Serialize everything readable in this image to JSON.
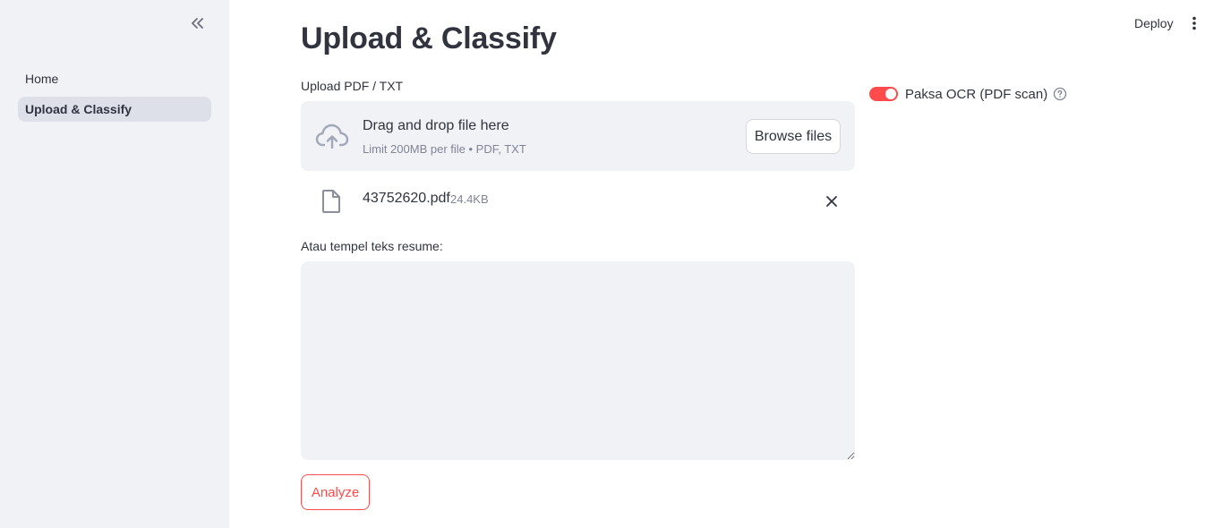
{
  "sidebar": {
    "collapse_icon": "double-chevron-left-icon",
    "items": [
      {
        "label": "Home",
        "active": false
      },
      {
        "label": "Upload & Classify",
        "active": true
      }
    ]
  },
  "topbar": {
    "deploy_label": "Deploy",
    "menu_icon": "vertical-ellipsis-icon"
  },
  "main": {
    "title": "Upload & Classify",
    "uploader": {
      "label": "Upload PDF / TXT",
      "drop_title": "Drag and drop file here",
      "limit_text": "Limit 200MB per file • PDF, TXT",
      "browse_label": "Browse files",
      "icon": "cloud-upload-icon"
    },
    "file": {
      "name": "43752620.pdf",
      "size": "24.4KB",
      "icon": "file-icon",
      "remove_icon": "close-icon"
    },
    "textarea": {
      "label": "Atau tempel teks resume:",
      "value": ""
    },
    "analyze_label": "Analyze"
  },
  "ocr_toggle": {
    "label": "Paksa OCR (PDF scan)",
    "checked": true,
    "help_icon": "question-circle-icon"
  },
  "colors": {
    "accent": "#ff4b4b",
    "sidebar_bg": "#f0f2f6",
    "text": "#31333f",
    "muted": "#808495"
  }
}
